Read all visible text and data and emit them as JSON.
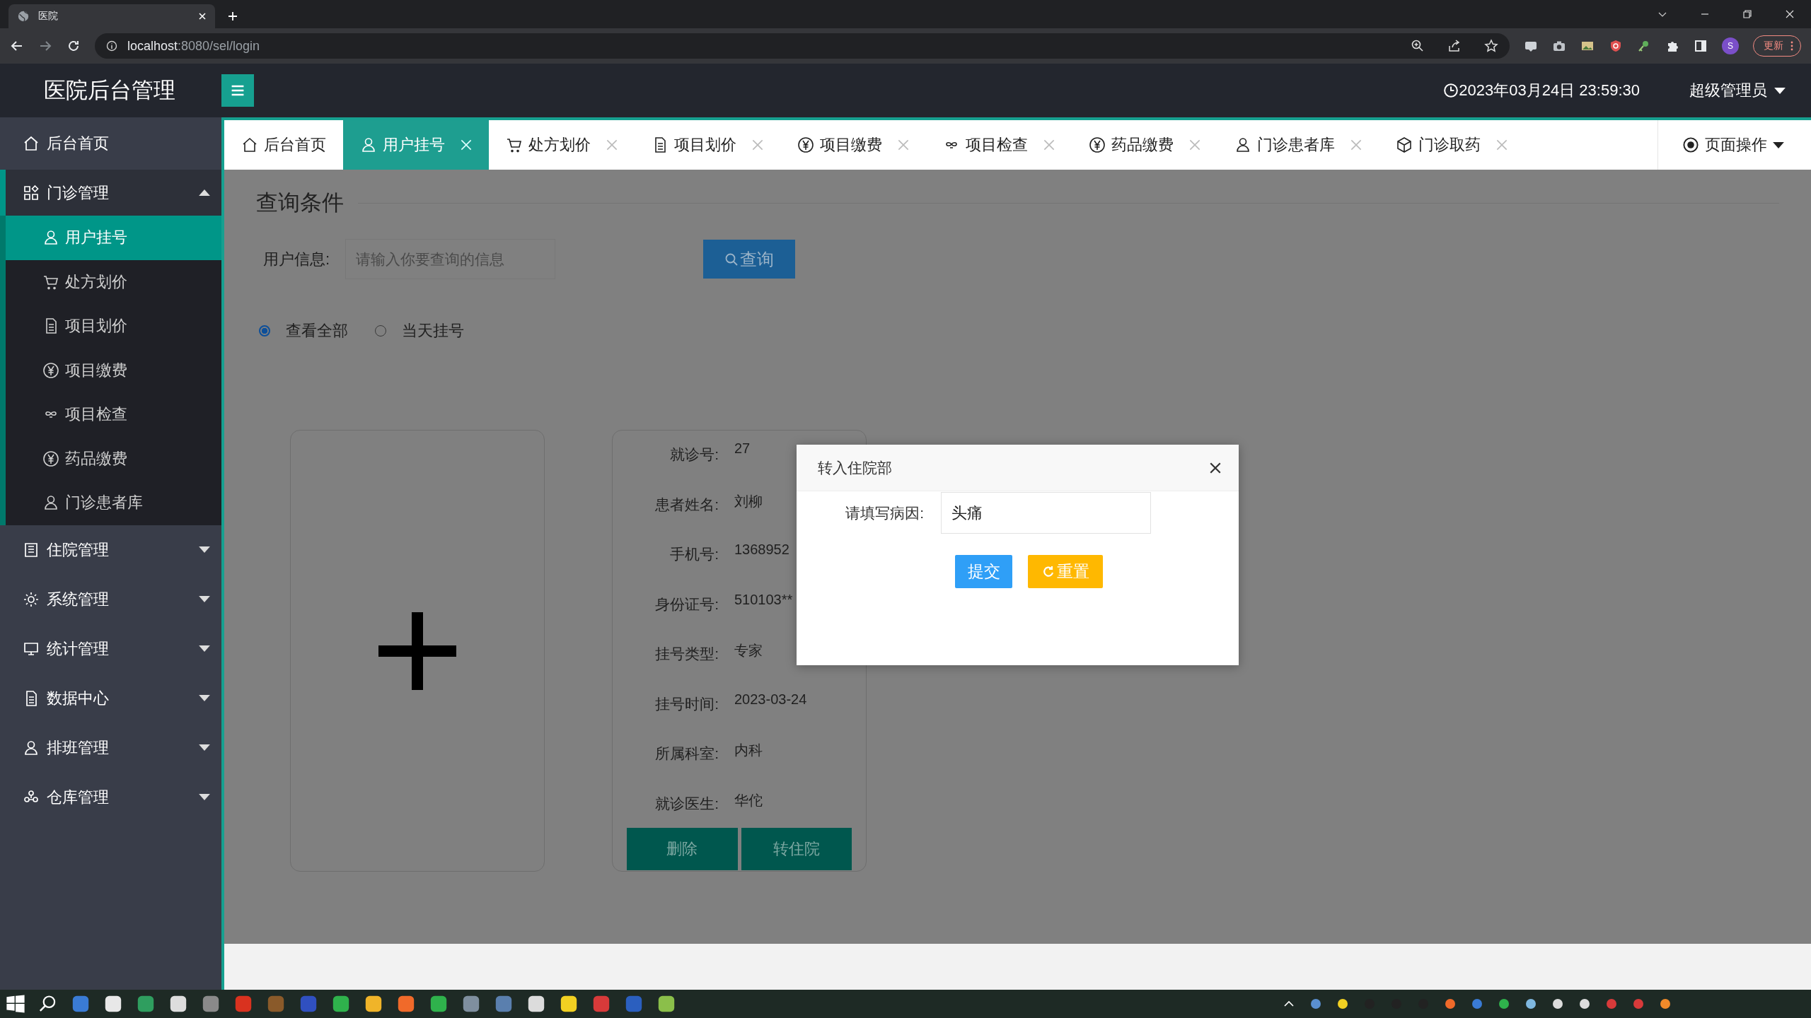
{
  "browser": {
    "tab_title": "医院",
    "address_host": "localhost",
    "address_rest": ":8080/sel/login",
    "avatar": "S",
    "update_button": "更新"
  },
  "header": {
    "title": "医院后台管理",
    "datetime": "2023年03月24日 23:59:30",
    "user": "超级管理员"
  },
  "tabs": [
    {
      "label": "后台首页",
      "selected": false,
      "closable": false
    },
    {
      "label": "用户挂号",
      "selected": true,
      "closable": true
    },
    {
      "label": "处方划价",
      "selected": false,
      "closable": true
    },
    {
      "label": "项目划价",
      "selected": false,
      "closable": true
    },
    {
      "label": "项目缴费",
      "selected": false,
      "closable": true
    },
    {
      "label": "项目检查",
      "selected": false,
      "closable": true
    },
    {
      "label": "药品缴费",
      "selected": false,
      "closable": true
    },
    {
      "label": "门诊患者库",
      "selected": false,
      "closable": true
    },
    {
      "label": "门诊取药",
      "selected": false,
      "closable": true
    }
  ],
  "page_action": "页面操作",
  "sidebar": {
    "items": [
      {
        "label": "后台首页",
        "kind": "link",
        "expanded": false
      },
      {
        "label": "门诊管理",
        "kind": "group",
        "expanded": true,
        "children": [
          {
            "label": "用户挂号",
            "selected": true
          },
          {
            "label": "处方划价",
            "selected": false
          },
          {
            "label": "项目划价",
            "selected": false
          },
          {
            "label": "项目缴费",
            "selected": false
          },
          {
            "label": "项目检查",
            "selected": false
          },
          {
            "label": "药品缴费",
            "selected": false
          },
          {
            "label": "门诊患者库",
            "selected": false
          }
        ]
      },
      {
        "label": "住院管理",
        "kind": "group",
        "expanded": false
      },
      {
        "label": "系统管理",
        "kind": "group",
        "expanded": false
      },
      {
        "label": "统计管理",
        "kind": "group",
        "expanded": false
      },
      {
        "label": "数据中心",
        "kind": "group",
        "expanded": false
      },
      {
        "label": "排班管理",
        "kind": "group",
        "expanded": false
      },
      {
        "label": "仓库管理",
        "kind": "group",
        "expanded": false
      }
    ]
  },
  "search": {
    "legend": "查询条件",
    "label": "用户信息:",
    "placeholder": "请输入你要查询的信息",
    "button": "查询"
  },
  "filter_radios": [
    {
      "label": "查看全部",
      "selected": true
    },
    {
      "label": "当天挂号",
      "selected": false
    }
  ],
  "patient_card": {
    "fields": [
      {
        "label": "就诊号:",
        "value": "27"
      },
      {
        "label": "患者姓名:",
        "value": "刘柳"
      },
      {
        "label": "手机号:",
        "value": "1368952"
      },
      {
        "label": "身份证号:",
        "value": "510103**"
      },
      {
        "label": "挂号类型:",
        "value": "专家"
      },
      {
        "label": "挂号时间:",
        "value": "2023-03-24"
      },
      {
        "label": "所属科室:",
        "value": "内科"
      },
      {
        "label": "就诊医生:",
        "value": "华佗"
      }
    ],
    "buttons": [
      "删除",
      "转住院"
    ]
  },
  "dialog": {
    "title": "转入住院部",
    "field_label": "请填写病因:",
    "field_value": "头痛",
    "buttons": [
      {
        "label": "提交",
        "kind": "primary"
      },
      {
        "label": "重置",
        "kind": "reset"
      }
    ]
  }
}
